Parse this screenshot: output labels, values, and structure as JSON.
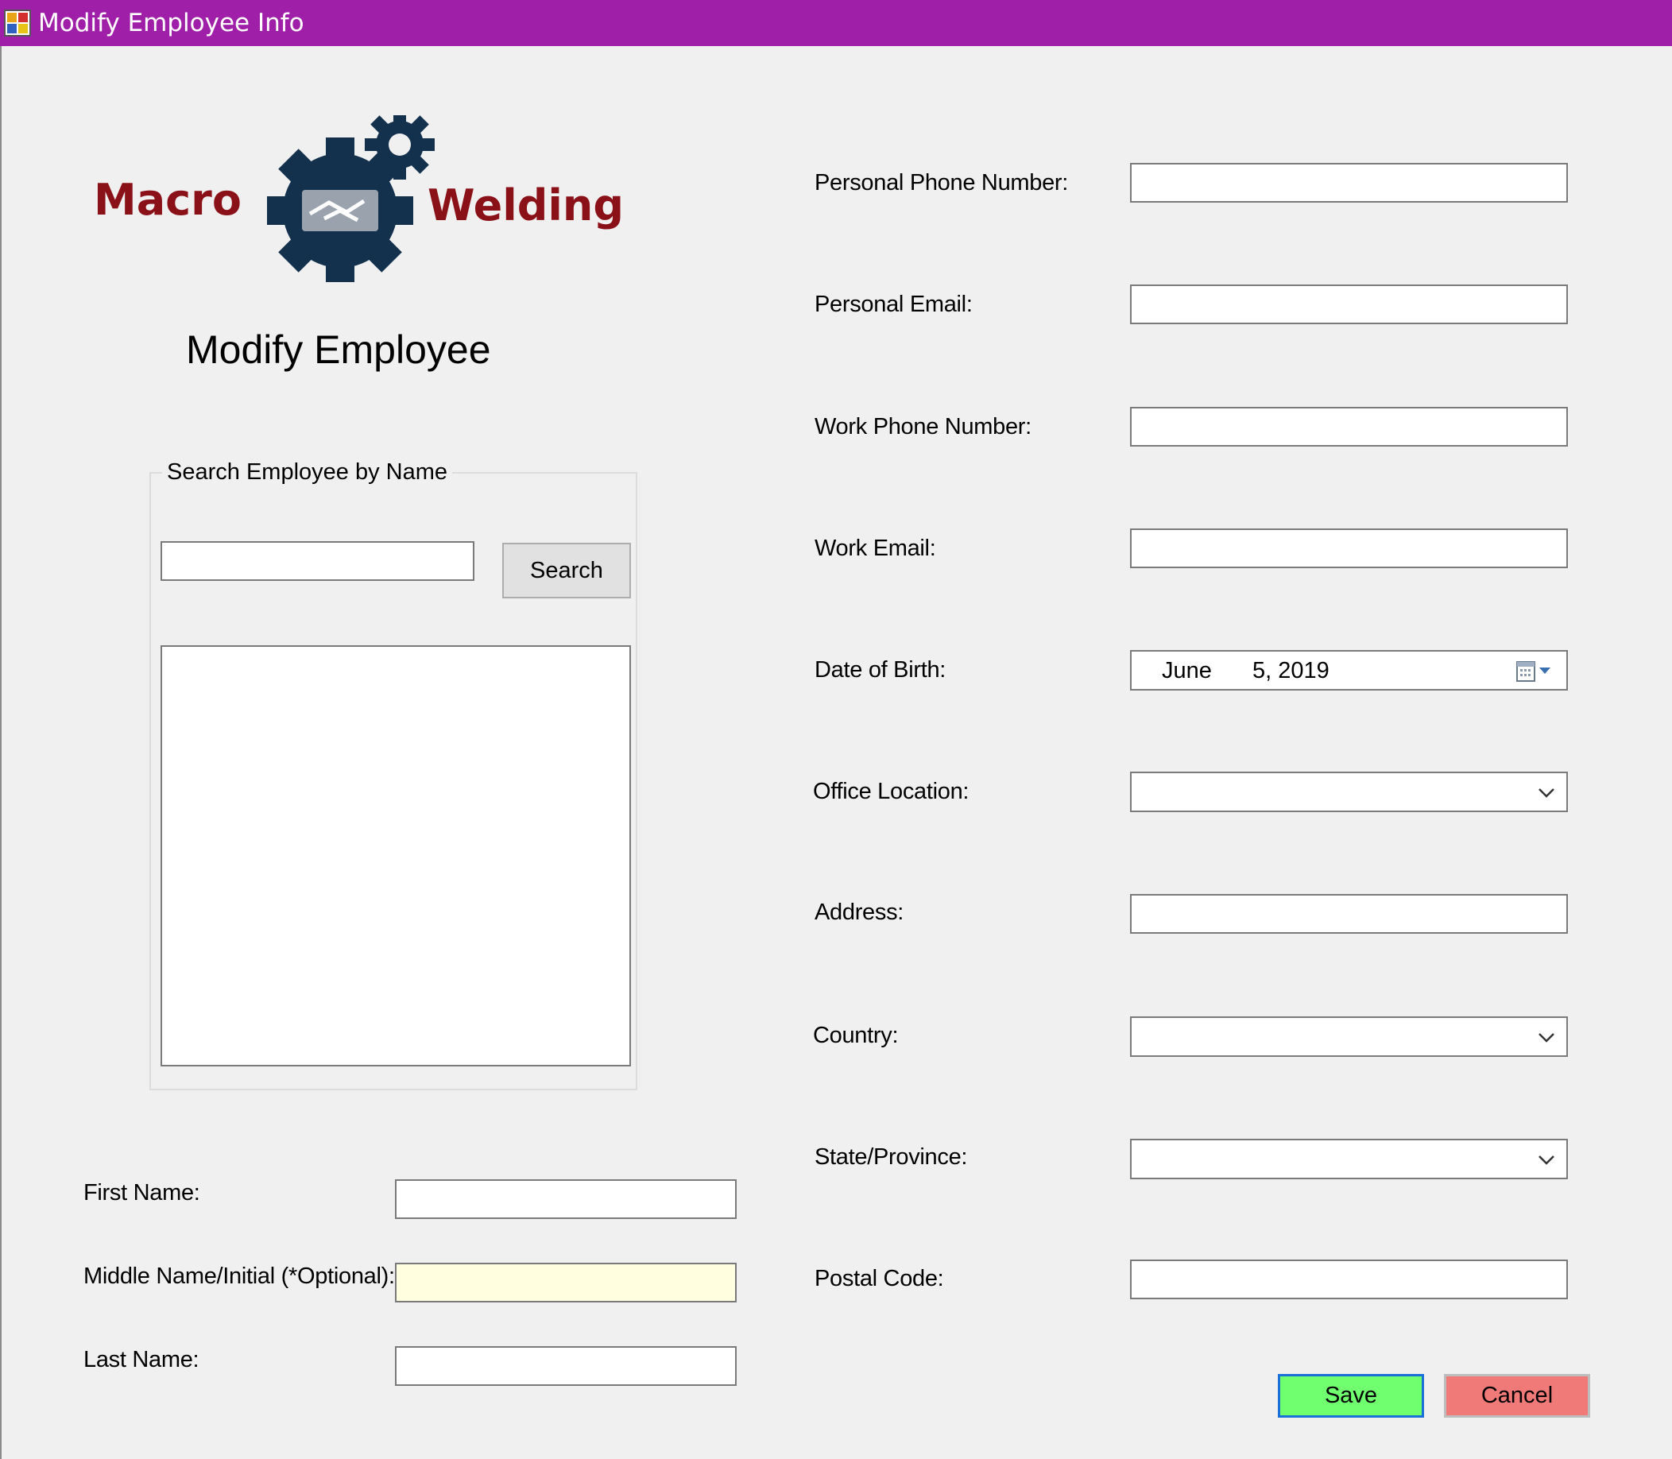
{
  "window": {
    "title": "Modify Employee Info",
    "title_bar_color": "#a01fa8"
  },
  "logo": {
    "left_text": "Macro",
    "right_text": "Welding",
    "text_color": "#8b1118",
    "gear_color": "#13304d"
  },
  "heading": "Modify Employee",
  "search_group": {
    "label": "Search Employee by Name",
    "search_value": "",
    "search_button": "Search",
    "results": []
  },
  "name_fields": {
    "first_name_label": "First Name:",
    "first_name_value": "",
    "middle_name_label": "Middle Name/Initial (*Optional):",
    "middle_name_value": "",
    "last_name_label": "Last Name:",
    "last_name_value": ""
  },
  "contact_fields": {
    "personal_phone_label": "Personal Phone Number:",
    "personal_phone_value": "",
    "personal_email_label": "Personal Email:",
    "personal_email_value": "",
    "work_phone_label": "Work Phone Number:",
    "work_phone_value": "",
    "work_email_label": "Work Email:",
    "work_email_value": "",
    "dob_label": "Date of Birth:",
    "dob_month": "June",
    "dob_day_year": "5, 2019",
    "office_location_label": "Office Location:",
    "office_location_value": "",
    "address_label": "Address:",
    "address_value": "",
    "country_label": "Country:",
    "country_value": "",
    "state_label": "State/Province:",
    "state_value": "",
    "postal_code_label": "Postal Code:",
    "postal_code_value": ""
  },
  "actions": {
    "save": "Save",
    "cancel": "Cancel",
    "save_color": "#6fff6f",
    "cancel_color": "#f07a78"
  }
}
